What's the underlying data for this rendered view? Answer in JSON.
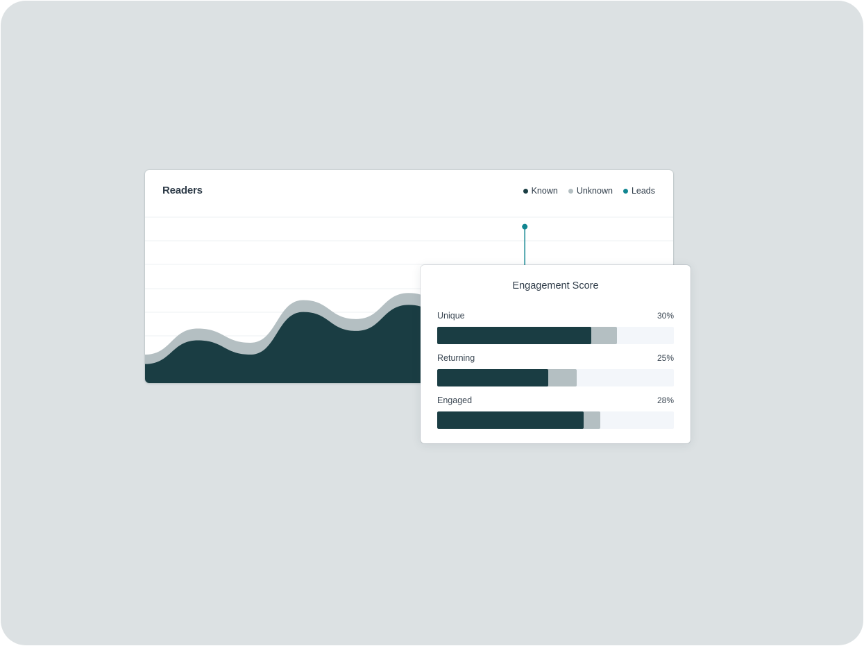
{
  "colors": {
    "background": "#dce1e3",
    "known": "#1a3d43",
    "unknown": "#b4bfc2",
    "leads": "#118691",
    "gridline": "#eef1f3",
    "track": "#f3f6fa"
  },
  "readers": {
    "title": "Readers",
    "legend": [
      {
        "label": "Known",
        "color": "#1a3d43"
      },
      {
        "label": "Unknown",
        "color": "#b4bfc2"
      },
      {
        "label": "Leads",
        "color": "#118691"
      }
    ]
  },
  "engagement": {
    "title": "Engagement Score",
    "metrics": [
      {
        "label": "Unique",
        "value_text": "30%",
        "primary_fraction": 0.65,
        "secondary_fraction": 0.76
      },
      {
        "label": "Returning",
        "value_text": "25%",
        "primary_fraction": 0.47,
        "secondary_fraction": 0.59
      },
      {
        "label": "Engaged",
        "value_text": "28%",
        "primary_fraction": 0.62,
        "secondary_fraction": 0.69
      }
    ]
  },
  "chart_data": {
    "type": "area",
    "title": "Readers",
    "legend": [
      "Known",
      "Unknown",
      "Leads"
    ],
    "legend_position": "top-right",
    "grid": true,
    "ylim": [
      0,
      7
    ],
    "x": [
      0,
      1,
      2,
      3,
      4,
      5,
      6,
      7,
      8,
      9,
      10
    ],
    "series": [
      {
        "name": "Known",
        "values": [
          0.8,
          1.8,
          1.2,
          3.0,
          2.2,
          3.3,
          2.5,
          3.0,
          3.4,
          3.1,
          3.6
        ]
      },
      {
        "name": "Unknown",
        "values": [
          1.2,
          2.3,
          1.7,
          3.5,
          2.7,
          3.8,
          3.0,
          3.5,
          3.9,
          3.6,
          4.1
        ]
      }
    ],
    "leads_marker": {
      "x": 7.2,
      "y": 6.6
    }
  }
}
